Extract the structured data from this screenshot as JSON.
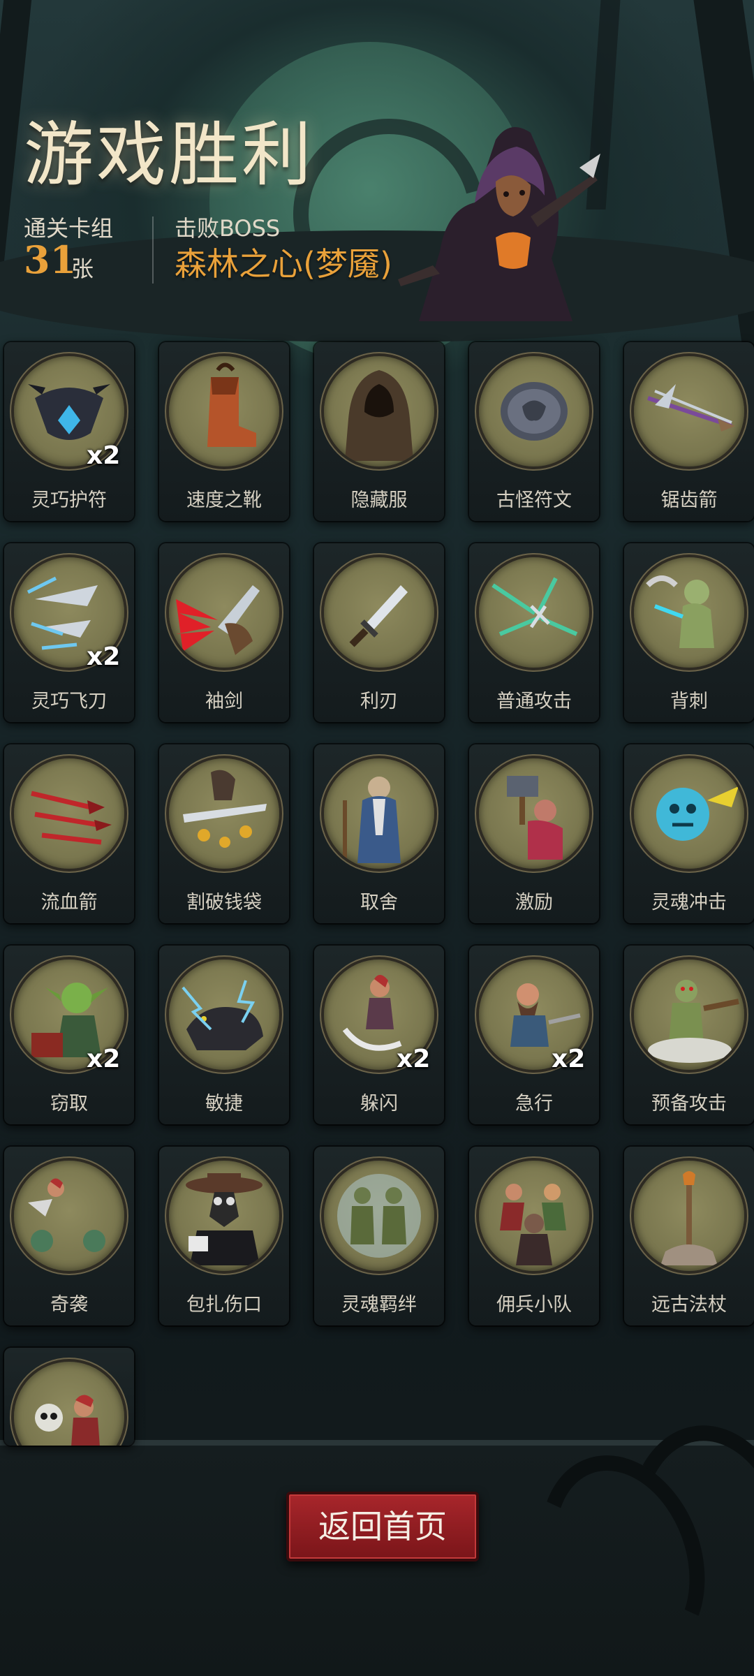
{
  "header": {
    "title": "游戏胜利",
    "deck_label": "通关卡组",
    "deck_count": "31",
    "deck_unit": "张",
    "boss_label": "击败BOSS",
    "boss_name": "森林之心(梦魇)"
  },
  "cards": [
    {
      "name": "灵巧护符",
      "count": "x2",
      "icon": "shield-charm-icon"
    },
    {
      "name": "速度之靴",
      "count": "",
      "icon": "boot-icon"
    },
    {
      "name": "隐藏服",
      "count": "",
      "icon": "hooded-cloak-icon"
    },
    {
      "name": "古怪符文",
      "count": "",
      "icon": "rune-stone-icon"
    },
    {
      "name": "锯齿箭",
      "count": "",
      "icon": "serrated-arrow-icon"
    },
    {
      "name": "灵巧飞刀",
      "count": "x2",
      "icon": "throwing-knives-icon"
    },
    {
      "name": "袖剑",
      "count": "",
      "icon": "sleeve-blade-icon"
    },
    {
      "name": "利刃",
      "count": "",
      "icon": "dagger-icon"
    },
    {
      "name": "普通攻击",
      "count": "",
      "icon": "arrow-volley-icon"
    },
    {
      "name": "背刺",
      "count": "",
      "icon": "backstab-icon"
    },
    {
      "name": "流血箭",
      "count": "",
      "icon": "bleeding-arrows-icon"
    },
    {
      "name": "割破钱袋",
      "count": "",
      "icon": "cut-purse-icon"
    },
    {
      "name": "取舍",
      "count": "",
      "icon": "wizard-icon"
    },
    {
      "name": "激励",
      "count": "",
      "icon": "hammer-warrior-icon"
    },
    {
      "name": "灵魂冲击",
      "count": "",
      "icon": "soul-blast-icon"
    },
    {
      "name": "窃取",
      "count": "x2",
      "icon": "goblin-thief-icon"
    },
    {
      "name": "敏捷",
      "count": "",
      "icon": "panther-icon"
    },
    {
      "name": "躲闪",
      "count": "x2",
      "icon": "dodge-icon"
    },
    {
      "name": "急行",
      "count": "x2",
      "icon": "dwarf-dash-icon"
    },
    {
      "name": "预备攻击",
      "count": "",
      "icon": "ready-strike-icon"
    },
    {
      "name": "奇袭",
      "count": "",
      "icon": "ambush-icon"
    },
    {
      "name": "包扎伤口",
      "count": "",
      "icon": "plague-doctor-icon"
    },
    {
      "name": "灵魂羁绊",
      "count": "",
      "icon": "soul-bond-icon"
    },
    {
      "name": "佣兵小队",
      "count": "",
      "icon": "mercenary-squad-icon"
    },
    {
      "name": "远古法杖",
      "count": "",
      "icon": "ancient-staff-icon"
    },
    {
      "name": "",
      "count": "",
      "icon": "skull-rogue-icon"
    }
  ],
  "back_button": {
    "label": "返回首页"
  },
  "colors": {
    "accent_gold": "#e9a13a",
    "title": "#f2e6c8",
    "button_red": "#a8262b",
    "card_art_bg": "#7a774f"
  }
}
